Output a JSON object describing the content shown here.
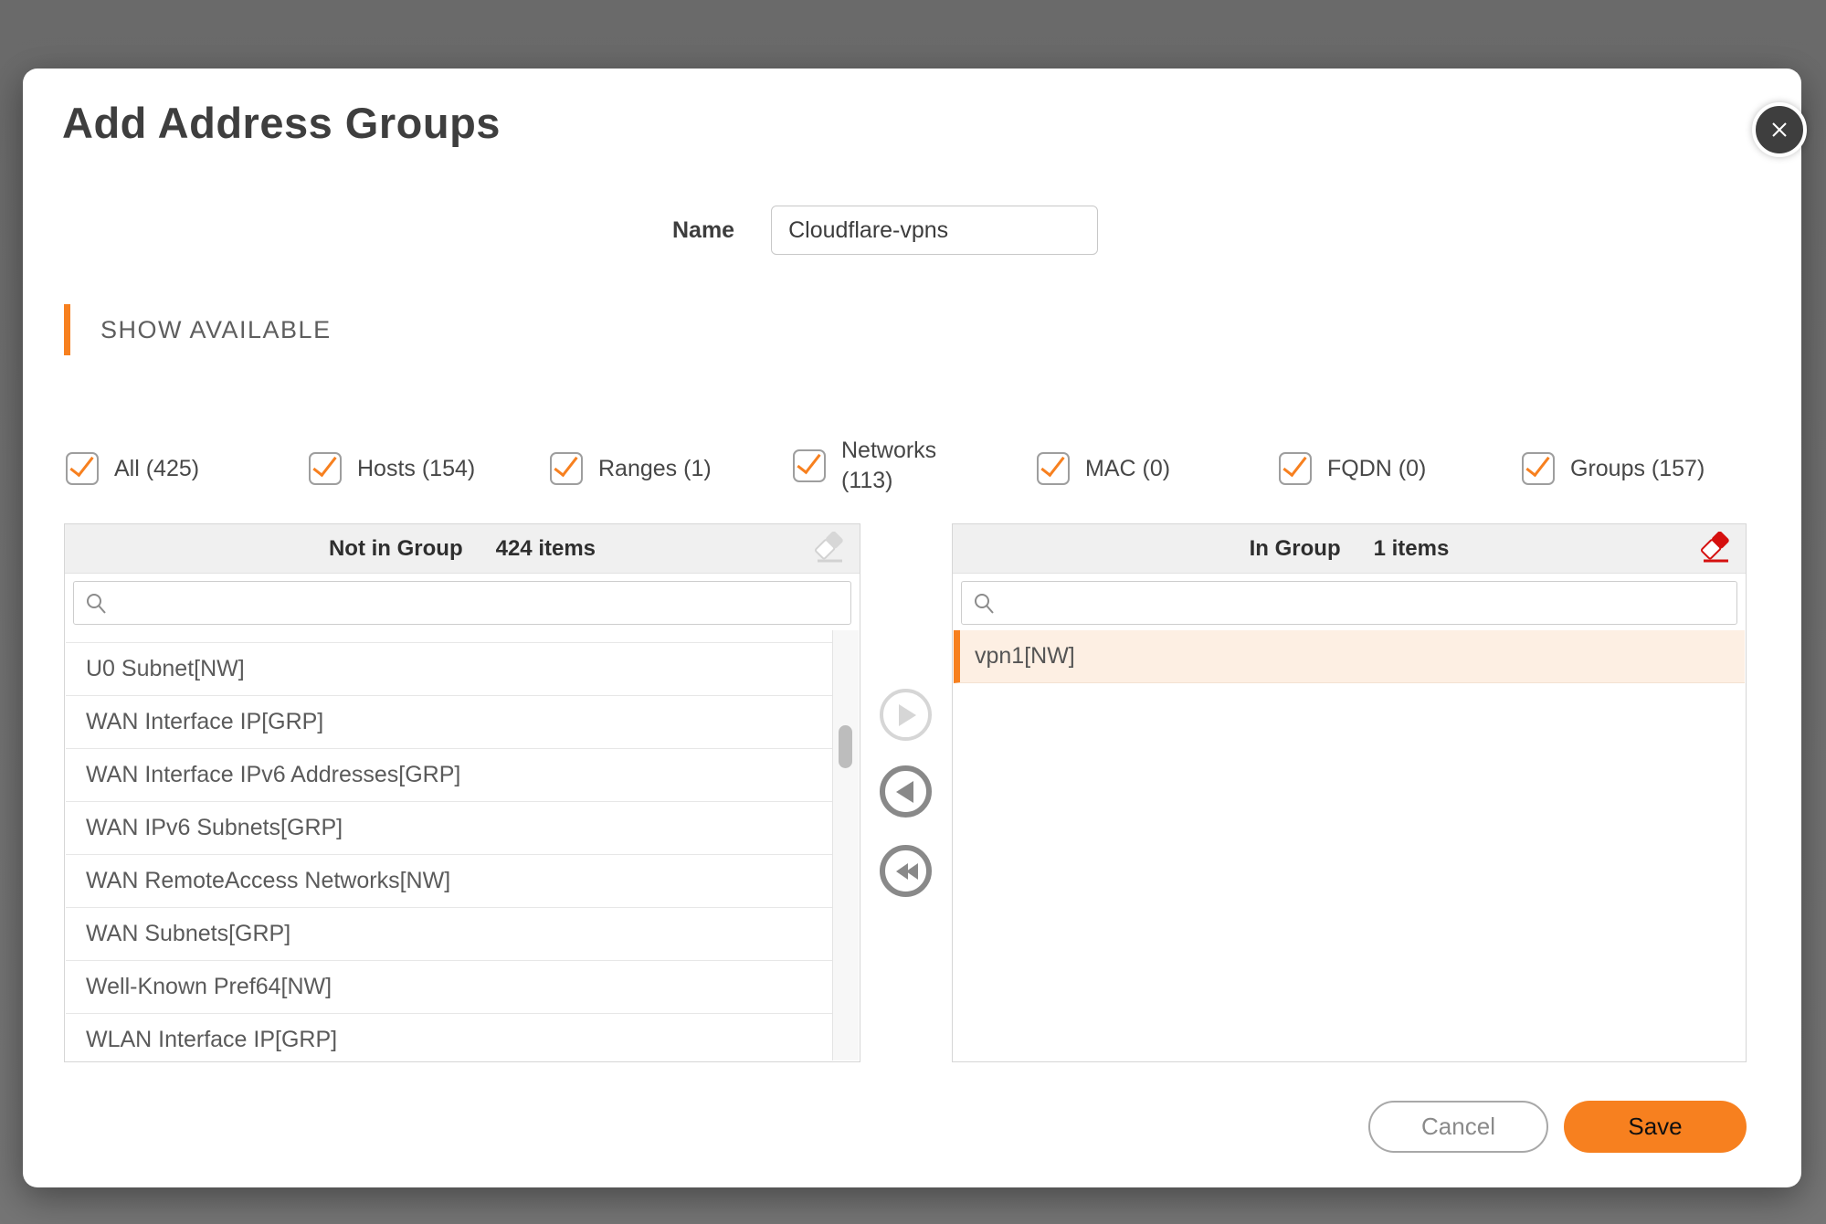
{
  "colors": {
    "accent_orange": "#F7801F",
    "selected_bg": "#FDEFE3",
    "eraser_red": "#D5100F",
    "eraser_gray": "#D2D2D2"
  },
  "modal": {
    "title": "Add Address Groups"
  },
  "name_field": {
    "label": "Name",
    "value": "Cloudflare-vpns"
  },
  "section": {
    "label": "SHOW AVAILABLE"
  },
  "filters": [
    {
      "id": "all",
      "label": "All (425)",
      "checked": true
    },
    {
      "id": "hosts",
      "label": "Hosts (154)",
      "checked": true
    },
    {
      "id": "ranges",
      "label": "Ranges (1)",
      "checked": true
    },
    {
      "id": "networks",
      "label": "Networks (113)",
      "checked": true,
      "multiline": true
    },
    {
      "id": "mac",
      "label": "MAC (0)",
      "checked": true
    },
    {
      "id": "fqdn",
      "label": "FQDN (0)",
      "checked": true
    },
    {
      "id": "groups",
      "label": "Groups (157)",
      "checked": true
    }
  ],
  "left_panel": {
    "title": "Not in Group",
    "count": "424 items",
    "items": [
      "U0 Subnet[NW]",
      "WAN Interface IP[GRP]",
      "WAN Interface IPv6 Addresses[GRP]",
      "WAN IPv6 Subnets[GRP]",
      "WAN RemoteAccess Networks[NW]",
      "WAN Subnets[GRP]",
      "Well-Known Pref64[NW]",
      "WLAN Interface IP[GRP]"
    ]
  },
  "right_panel": {
    "title": "In Group",
    "count": "1 items",
    "items": [
      {
        "label": "vpn1[NW]",
        "selected": true
      }
    ]
  },
  "footer": {
    "cancel_label": "Cancel",
    "save_label": "Save"
  }
}
